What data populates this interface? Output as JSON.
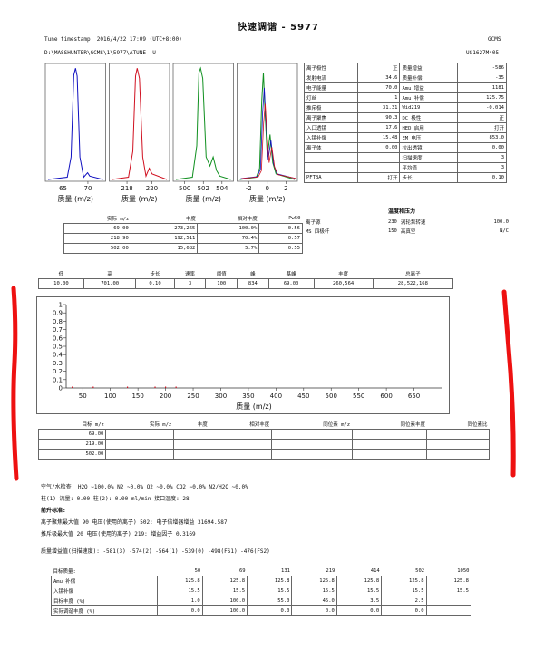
{
  "title": "快速调谐 - 5977",
  "header": {
    "tune_timestamp": "Tune timestamp: 2016/4/22 17:09  (UTC+8:00)",
    "file_path": "D:\\MASSHUNTER\\GCMS\\1\\5977\\ATUNE .U",
    "instrument": "GCMS",
    "serial": "US1627M405"
  },
  "peak_panels": [
    {
      "ticks": [
        "65",
        "70"
      ],
      "xlabel": "质量 (m/z)",
      "color": "#1010c0"
    },
    {
      "ticks": [
        "218",
        "220"
      ],
      "xlabel": "质量 (m/z)",
      "color": "#d01020"
    },
    {
      "ticks": [
        "500",
        "502",
        "504"
      ],
      "xlabel": "质量 (m/z)",
      "color": "#109020"
    },
    {
      "ticks": [
        "-2",
        "0",
        "2"
      ],
      "xlabel": "质量 (m/z)",
      "color": "#109020"
    }
  ],
  "params_left": [
    [
      "离子极性",
      "正"
    ],
    [
      "发射电流",
      "34.6"
    ],
    [
      "电子能量",
      "70.0"
    ],
    [
      "灯丝",
      "1"
    ],
    [
      "推斥极",
      "31.31"
    ],
    [
      "离子聚焦",
      "90.3"
    ],
    [
      "入口透镜",
      "17.6"
    ],
    [
      "入镜补偿",
      "15.48"
    ],
    [
      "离子体",
      "0.00"
    ],
    [
      "",
      ""
    ],
    [
      "",
      ""
    ],
    [
      "PFTBA",
      "打开"
    ]
  ],
  "params_right": [
    [
      "质量增益",
      "-586"
    ],
    [
      "质量补偿",
      "-35"
    ],
    [
      "Amu 增益",
      "1181"
    ],
    [
      "Amu 补偿",
      "125.75"
    ],
    [
      "Wid219",
      "-0.014"
    ],
    [
      "DC 极性",
      "正"
    ],
    [
      "HED 启用",
      "打开"
    ],
    [
      "EM 电压",
      "853.0"
    ],
    [
      "拉出透镜",
      "0.00"
    ],
    [
      "扫描速度",
      "3"
    ],
    [
      "平均值",
      "3"
    ],
    [
      "步长",
      "0.10"
    ]
  ],
  "temp_pressure": {
    "title": "温度和压力",
    "rows": [
      [
        "离子源",
        "230",
        "涡轮泵转速",
        "100.0"
      ],
      [
        "MS 四极杆",
        "150",
        "高真空",
        "N/C"
      ]
    ]
  },
  "mass_table": {
    "headers": [
      "实际 m/z",
      "丰度",
      "相对丰度",
      "Pw50"
    ],
    "rows": [
      [
        "69.00",
        "273,265",
        "100.0%",
        "0.56"
      ],
      [
        "218.90",
        "192,511",
        "70.4%",
        "0.57"
      ],
      [
        "502.00",
        "15,682",
        "5.7%",
        "0.55"
      ]
    ]
  },
  "scan_table": {
    "headers": [
      "低",
      "高",
      "步长",
      "速率",
      "阈值",
      "峰",
      "基峰",
      "丰度",
      "总离子"
    ],
    "values": [
      "10.00",
      "701.00",
      "0.10",
      "3",
      "100",
      "834",
      "69.00",
      "260,564",
      "28,522,168"
    ]
  },
  "chart_data": {
    "type": "line",
    "xlabel": "质量 (m/z)",
    "x_ticks": [
      "50",
      "100",
      "150",
      "200",
      "250",
      "300",
      "350",
      "400",
      "450",
      "500",
      "550",
      "600",
      "650"
    ],
    "y_ticks": [
      "0",
      "0.1",
      "0.2",
      "0.3",
      "0.4",
      "0.5",
      "0.6",
      "0.7",
      "0.8",
      "0.9",
      "1"
    ],
    "xlim": [
      20,
      700
    ],
    "ylim": [
      0,
      1
    ],
    "peaks": [
      {
        "x": 31,
        "y": 0.005
      },
      {
        "x": 69,
        "y": 0.01
      },
      {
        "x": 131,
        "y": 0.004
      },
      {
        "x": 181,
        "y": 0.008
      },
      {
        "x": 200,
        "y": 0.009
      },
      {
        "x": 219,
        "y": 0.006
      }
    ],
    "series_color": "#d01020"
  },
  "target_table": {
    "headers": [
      "目标 m/z",
      "实际 m/z",
      "丰度",
      "相对丰度",
      "同位素 m/z",
      "同位素丰度",
      "同位素比"
    ],
    "rows": [
      [
        "69.00"
      ],
      [
        "219.00"
      ],
      [
        "502.00"
      ]
    ]
  },
  "air_water": {
    "line1": "空气/水检查:   H2O ~100.0%  N2 ~0.0%  O2 ~0.0%  CO2 ~0.0%  N2/H2O ~0.0%",
    "line2": "柱(1) 流量:  0.00   柱(2):  0.00 ml/min   接口温度:  28",
    "heading": "前升标准:",
    "line3": "离子聚焦最大值    90  电压(使用的离子)  502:     电子倍增器增益 31694.587",
    "line4": "推斥极最大值     20 电压(使用的离子)  219:  增益因子   0.3169",
    "line5": "质量增益值(扫描速度): -581(3)  -574(2)  -564(1)  -539(0)  -498(FS1)   -476(FS2)"
  },
  "target_mass_table": {
    "headers": [
      "目标质量:",
      "50",
      "69",
      "131",
      "219",
      "414",
      "502",
      "1050"
    ],
    "rows": [
      [
        "Amu 补偿",
        "125.8",
        "125.8",
        "125.8",
        "125.8",
        "125.8",
        "125.8",
        "125.8"
      ],
      [
        "入镜补偿",
        "15.5",
        "15.5",
        "15.5",
        "15.5",
        "15.5",
        "15.5",
        "15.5"
      ],
      [
        "目标丰度 (%)",
        "1.0",
        "100.0",
        "55.0",
        "45.0",
        "3.5",
        "2.5",
        ""
      ],
      [
        "实际调谐丰度 (%)",
        "0.0",
        "100.0",
        "0.0",
        "0.0",
        "0.0",
        "0.0",
        ""
      ]
    ]
  },
  "annotation_color": "#ee1111"
}
